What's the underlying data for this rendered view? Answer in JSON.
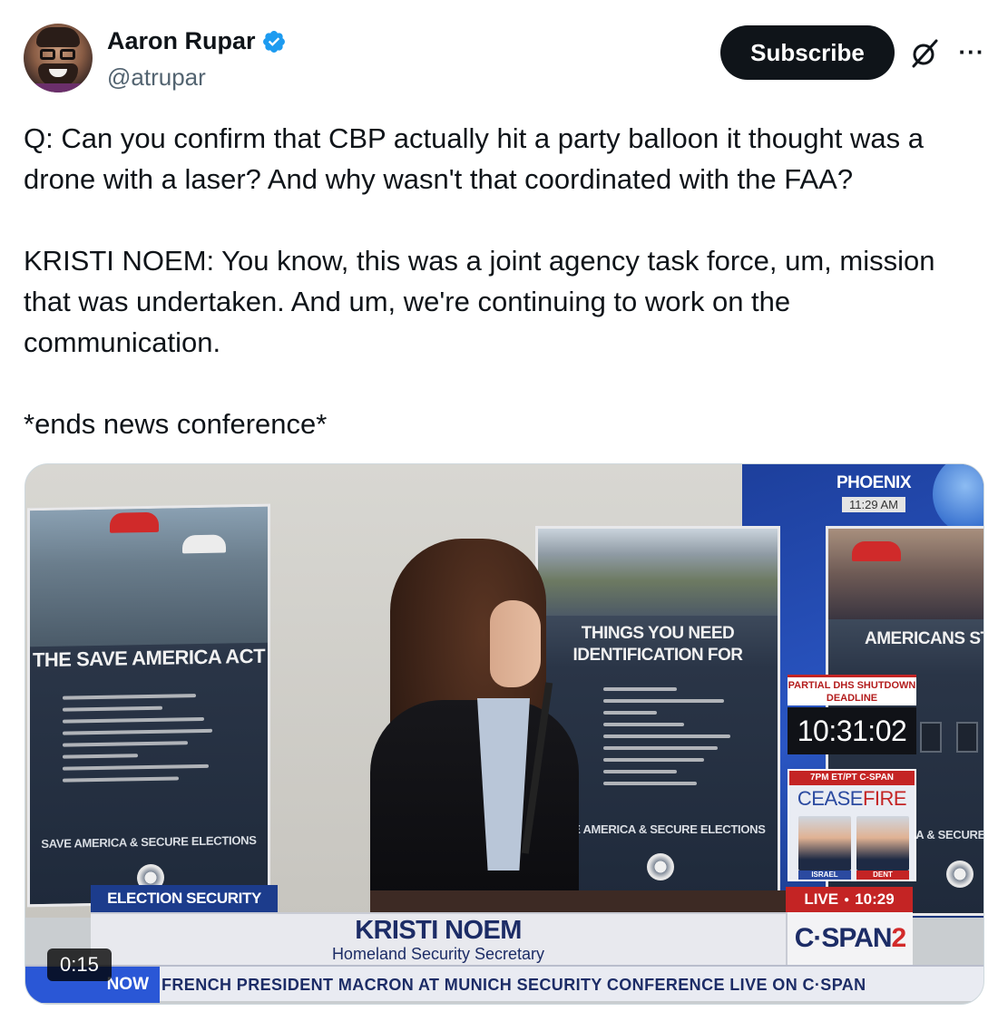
{
  "author": {
    "display_name": "Aaron Rupar",
    "handle": "@atrupar",
    "avatar_icon": "avatar-photo",
    "verified_icon": "verified-badge-icon"
  },
  "actions": {
    "subscribe_label": "Subscribe",
    "grok_icon": "grok-icon",
    "more_icon": "more-options-icon",
    "more_glyph": "···"
  },
  "tweet": {
    "paragraphs": [
      "Q: Can you confirm that CBP actually hit a party balloon it thought was a drone with a laser? And why wasn't that coordinated with the FAA?",
      "KRISTI NOEM: You know, this was a joint agency task force, um, mission that was undertaken. And um, we're continuing to work on the communication.",
      "*ends news conference*"
    ]
  },
  "video": {
    "duration": "0:15",
    "posters": {
      "left_title": "THE SAVE AMERICA ACT",
      "left_footer": "SAVE AMERICA & SECURE ELECTIONS",
      "mid_title": "THINGS YOU NEED IDENTIFICATION FOR",
      "mid_footer": "SAVE AMERICA & SECURE ELECTIONS",
      "right_title": "AMERICANS STI SUPPORT VOT",
      "right_footer": "CA & SECURE"
    },
    "chyron": {
      "tag": "ELECTION SECURITY",
      "name": "KRISTI NOEM",
      "title": "Homeland Security Secretary",
      "network": "C·SPAN",
      "network_num": "2",
      "live_label": "LIVE",
      "live_time": "10:29",
      "ticker_label": "NOW",
      "ticker_text": "FRENCH PRESIDENT MACRON AT MUNICH SECURITY CONFERENCE  LIVE ON C·SPAN"
    },
    "sidebar": {
      "city": "PHOENIX",
      "city_time": "11:29 AM",
      "dhs_label": "PARTIAL DHS SHUTDOWN DEADLINE",
      "dhs_timer": "10:31:02",
      "ceasefire_top": "7PM ET/PT C-SPAN",
      "ceasefire_word_a": "CEASE",
      "ceasefire_word_b": "FIRE",
      "tag_a": "ISRAEL",
      "tag_b": "DENT"
    }
  }
}
